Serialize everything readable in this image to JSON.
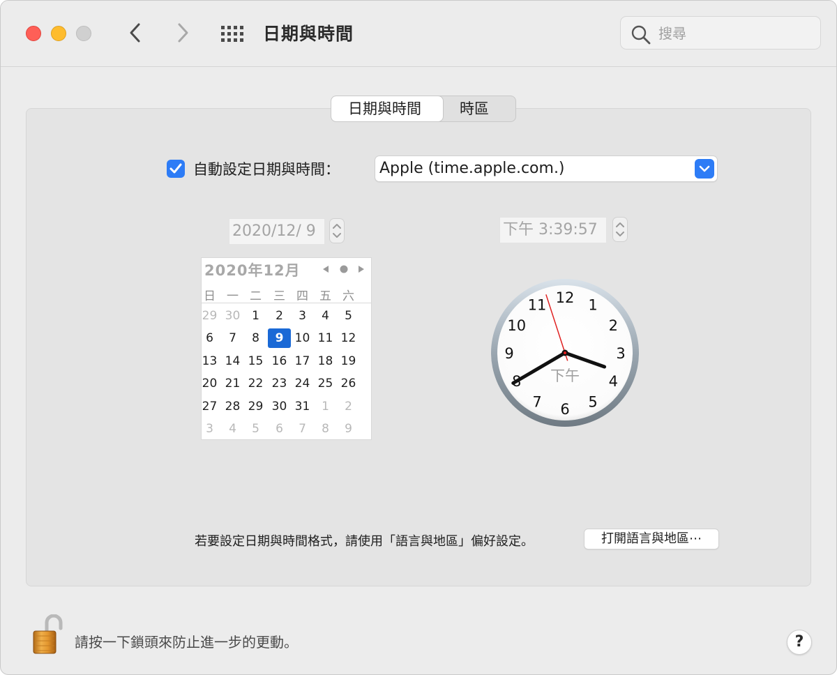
{
  "window": {
    "title": "日期與時間",
    "search_placeholder": "搜尋"
  },
  "tabs": [
    {
      "label": "日期與時間",
      "active": true
    },
    {
      "label": "時區",
      "active": false
    }
  ],
  "auto_setting": {
    "label": "自動設定日期與時間：",
    "checked": true,
    "server": "Apple (time.apple.com.)"
  },
  "date_field": {
    "value": "2020/12/ 9"
  },
  "time_field": {
    "value": "下午  3:39:57"
  },
  "calendar": {
    "title": "2020年12月",
    "weekdays": [
      "日",
      "一",
      "二",
      "三",
      "四",
      "五",
      "六"
    ],
    "weeks": [
      [
        "29",
        "30",
        "1",
        "2",
        "3",
        "4",
        "5"
      ],
      [
        "6",
        "7",
        "8",
        "9",
        "10",
        "11",
        "12"
      ],
      [
        "13",
        "14",
        "15",
        "16",
        "17",
        "18",
        "19"
      ],
      [
        "20",
        "21",
        "22",
        "23",
        "24",
        "25",
        "26"
      ],
      [
        "27",
        "28",
        "29",
        "30",
        "31",
        "1",
        "2"
      ],
      [
        "3",
        "4",
        "5",
        "6",
        "7",
        "8",
        "9"
      ]
    ],
    "selected_day": "9"
  },
  "clock": {
    "numbers": [
      "12",
      "1",
      "2",
      "3",
      "4",
      "5",
      "6",
      "7",
      "8",
      "9",
      "10",
      "11"
    ],
    "period_label": "下午",
    "hour": 3,
    "minute": 39,
    "second": 57
  },
  "format_note": "若要設定日期與時間格式，請使用「語言與地區」偏好設定。",
  "open_button": "打開語言與地區⋯",
  "lock_note": "請按一下鎖頭來防止進一步的更動。",
  "help_label": "?",
  "colors": {
    "accent": "#2d7cf6",
    "selected_day": "#1a69d6",
    "second_hand": "#e02020"
  }
}
